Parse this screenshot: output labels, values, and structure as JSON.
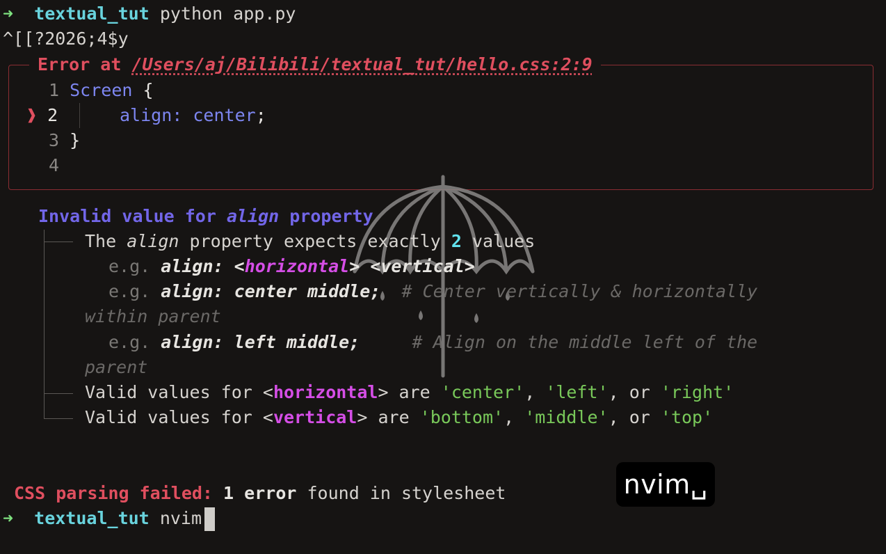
{
  "prompt1": {
    "arrow": "➜",
    "dir": "textual_tut",
    "cmd": "python app.py"
  },
  "escape_seq": "^[[?2026;4$y",
  "error_box": {
    "title_prefix": "Error at ",
    "path": "/Users/aj/Bilibili/textual_tut/hello.css:2:9",
    "marker": "❱",
    "lines": [
      {
        "num": "1",
        "tokens": [
          {
            "t": "Screen",
            "c": "blue"
          },
          {
            "t": " {",
            "c": "white"
          }
        ]
      },
      {
        "num": "2",
        "tokens": [
          {
            "t": "align",
            "c": "blue"
          },
          {
            "t": ": ",
            "c": "blue"
          },
          {
            "t": "center",
            "c": "blue"
          },
          {
            "t": ";",
            "c": "white"
          }
        ]
      },
      {
        "num": "3",
        "tokens": [
          {
            "t": "}",
            "c": "white"
          }
        ]
      },
      {
        "num": "4",
        "tokens": []
      }
    ]
  },
  "message": {
    "heading_a": "Invalid value for ",
    "heading_prop": "align",
    "heading_b": " property",
    "expects_a": "The ",
    "expects_prop": "align",
    "expects_b": " property expects exactly ",
    "expects_num": "2",
    "expects_c": " values",
    "eg": "e.g.",
    "ex1_a": "align: <",
    "ex1_h": "horizontal",
    "ex1_b": "> <vertical>",
    "ex2_code": "align: center middle;",
    "ex2_comment": "# Center vertically & horizontally",
    "ex2_wrap": "within parent",
    "ex3_code": "align: left middle;",
    "ex3_comment": "# Align on the middle left of the",
    "ex3_wrap": "parent",
    "h_a": "Valid values for <",
    "h_kw": "horizontal",
    "h_b": "> are ",
    "h_v1": "'center'",
    "h_v2": "'left'",
    "h_v3": "'right'",
    "v_a": "Valid values for <",
    "v_kw": "vertical",
    "v_b": "> are ",
    "v_v1": "'bottom'",
    "v_v2": "'middle'",
    "v_v3": "'top'",
    "sep_comma": ", ",
    "sep_or": ", or "
  },
  "failure": {
    "prefix": "CSS parsing failed:",
    "count": "1",
    "error_word": "error",
    "rest": " found in stylesheet"
  },
  "prompt2": {
    "arrow": "➜",
    "dir": "textual_tut",
    "cmd": "nvim"
  },
  "overlay_badge": "nvim␣",
  "colors": {
    "background": "#161413",
    "error": "#e04f5f",
    "directory": "#69d3dd",
    "arrow": "#7ee07f",
    "keyword": "#d54ee6",
    "string": "#79c95a"
  }
}
